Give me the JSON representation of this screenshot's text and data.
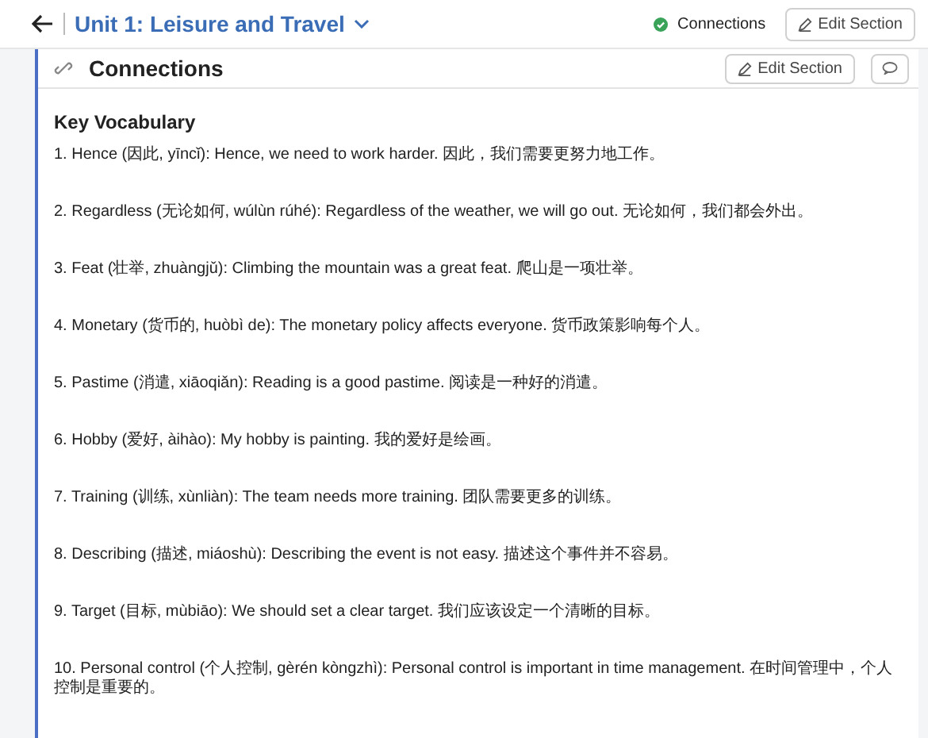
{
  "header": {
    "title": "Unit 1: Leisure and Travel",
    "status": "Connections",
    "edit_button": "Edit Section"
  },
  "section": {
    "title": "Connections",
    "edit_button": "Edit Section",
    "heading": "Key Vocabulary",
    "items": [
      "1. Hence (因此, yīncǐ): Hence, we need to work harder. 因此，我们需要更努力地工作。",
      "2. Regardless (无论如何, wúlùn rúhé): Regardless of the weather, we will go out. 无论如何，我们都会外出。",
      "3. Feat (壮举, zhuàngjǔ): Climbing the mountain was a great feat. 爬山是一项壮举。",
      "4. Monetary (货币的, huòbì de): The monetary policy affects everyone. 货币政策影响每个人。",
      "5. Pastime (消遣, xiāoqiǎn): Reading is a good pastime. 阅读是一种好的消遣。",
      "6. Hobby (爱好, àihào): My hobby is painting. 我的爱好是绘画。",
      "7. Training (训练, xùnliàn): The team needs more training. 团队需要更多的训练。",
      "8. Describing (描述, miáoshù): Describing the event is not easy. 描述这个事件并不容易。",
      "9. Target (目标, mùbiāo): We should set a clear target. 我们应该设定一个清晰的目标。",
      "10. Personal control (个人控制, gèrén kòngzhì): Personal control is important in time management. 在时间管理中，个人控制是重要的。"
    ]
  }
}
